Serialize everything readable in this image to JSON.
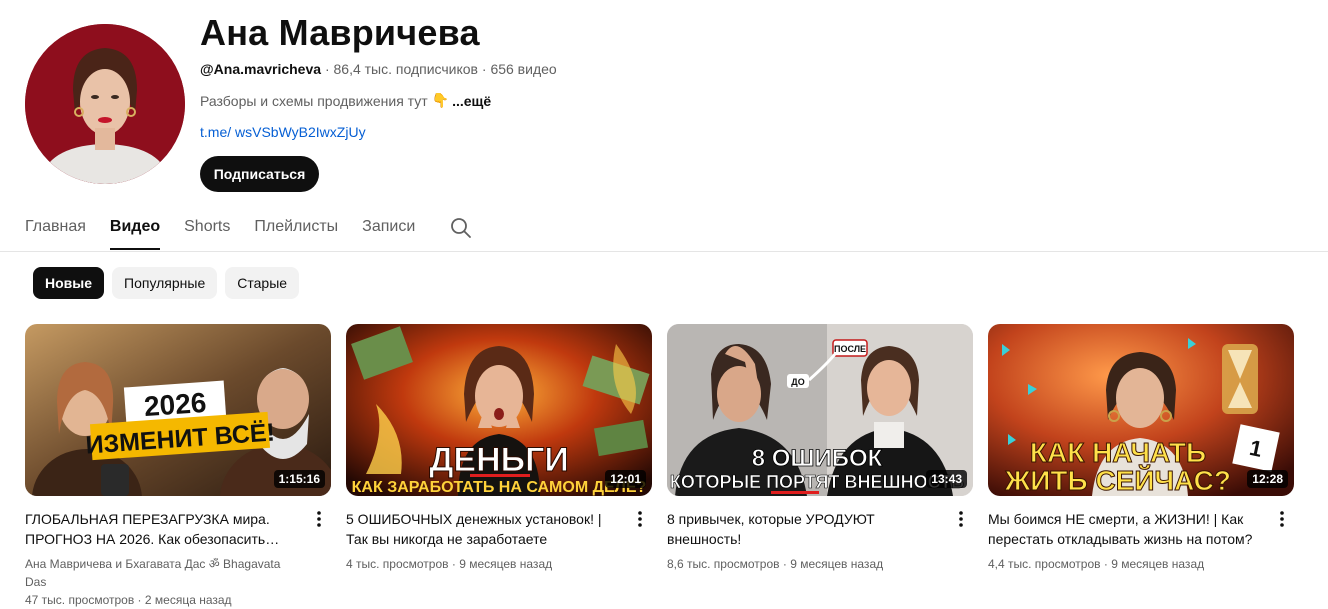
{
  "channel": {
    "name": "Ана Мавричева",
    "handle": "@Ana.mavricheva",
    "subscribers": "86,4 тыс. подписчиков",
    "video_count": "656 видео",
    "separator": "·",
    "description": "Разборы и схемы продвижения тут",
    "description_emoji": "👇",
    "more_label": "...ещё",
    "link": "t.me/ wsVSbWyB2IwxZjUy",
    "subscribe_label": "Подписаться"
  },
  "tabs": [
    {
      "label": "Главная",
      "active": false
    },
    {
      "label": "Видео",
      "active": true
    },
    {
      "label": "Shorts",
      "active": false
    },
    {
      "label": "Плейлисты",
      "active": false
    },
    {
      "label": "Записи",
      "active": false
    }
  ],
  "chips": [
    {
      "label": "Новые",
      "active": true
    },
    {
      "label": "Популярные",
      "active": false
    },
    {
      "label": "Старые",
      "active": false
    }
  ],
  "videos": [
    {
      "title": "ГЛОБАЛЬНАЯ ПЕРЕЗАГРУЗКА мира. ПРОГНОЗ НА 2026. Как обезопасить…",
      "duration": "1:15:16",
      "author": "Ана Мавричева и Бхагавата Дас ॐ Bhagavata Das",
      "views": "47 тыс. просмотров",
      "date": "2 месяца назад",
      "thumb_line1": "2026",
      "thumb_line2": "ИЗМЕНИТ ВСЁ!"
    },
    {
      "title": "5 ОШИБОЧНЫХ денежных установок! | Так вы никогда не заработаете",
      "duration": "12:01",
      "views": "4 тыс. просмотров",
      "date": "9 месяцев назад",
      "thumb_line1": "ДЕНЬГИ",
      "thumb_line2": "КАК ЗАРАБОТАТЬ НА САМОМ ДЕЛЕ?"
    },
    {
      "title": "8 привычек, которые УРОДУЮТ внешность!",
      "duration": "13:43",
      "views": "8,6 тыс. просмотров",
      "date": "9 месяцев назад",
      "thumb_line1": "8 ОШИБОК",
      "thumb_line2": "КОТОРЫЕ ПОРТЯТ ВНЕШНОСТЬ",
      "thumb_before": "ДО",
      "thumb_after": "ПОСЛЕ"
    },
    {
      "title": "Мы боимся НЕ смерти, а ЖИЗНИ! | Как перестать откладывать жизнь на потом?",
      "duration": "12:28",
      "views": "4,4 тыс. просмотров",
      "date": "9 месяцев назад",
      "thumb_line1": "КАК НАЧАТЬ",
      "thumb_line2": "ЖИТЬ СЕЙЧАС?"
    }
  ],
  "colors": {
    "accent": "#0f0f0f",
    "link": "#065fd4",
    "secondary_text": "#606060",
    "chip_bg": "#f2f2f2"
  }
}
